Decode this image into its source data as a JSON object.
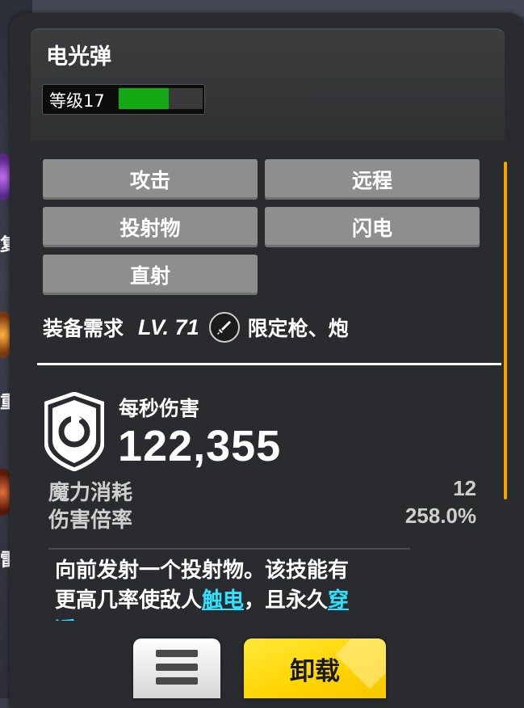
{
  "background": {
    "left_glyphs": [
      "复",
      "重",
      "雷"
    ]
  },
  "skill": {
    "name": "电光弹",
    "level_label": "等级17",
    "level_progress": 0.6
  },
  "tags": [
    "攻击",
    "远程",
    "投射物",
    "闪电",
    "直射"
  ],
  "requirement": {
    "label": "装备需求",
    "level": "LV. 71",
    "weapon_icon": "sword-icon",
    "weapon_text": "限定枪、炮"
  },
  "dps": {
    "label": "每秒伤害",
    "value": "122,355",
    "icon": "shield-refresh-icon"
  },
  "stats": [
    {
      "label": "魔力消耗",
      "value": "12"
    },
    {
      "label": "伤害倍率",
      "value": "258.0%"
    }
  ],
  "description": {
    "line1": "向前发射一个投射物。该技能有",
    "line2_pre": "更高几率使敌人",
    "line2_hl1": "触电",
    "line2_mid": "，且永久",
    "line2_hl2": "穿",
    "line3_hl": "透"
  },
  "buttons": {
    "menu_icon": "menu-icon",
    "unload_label": "卸载"
  },
  "colors": {
    "level_fill": "#14a814",
    "highlight": "#2fe3ff",
    "scrollbar": "#f5a500",
    "unload_button": "#ffd400"
  }
}
